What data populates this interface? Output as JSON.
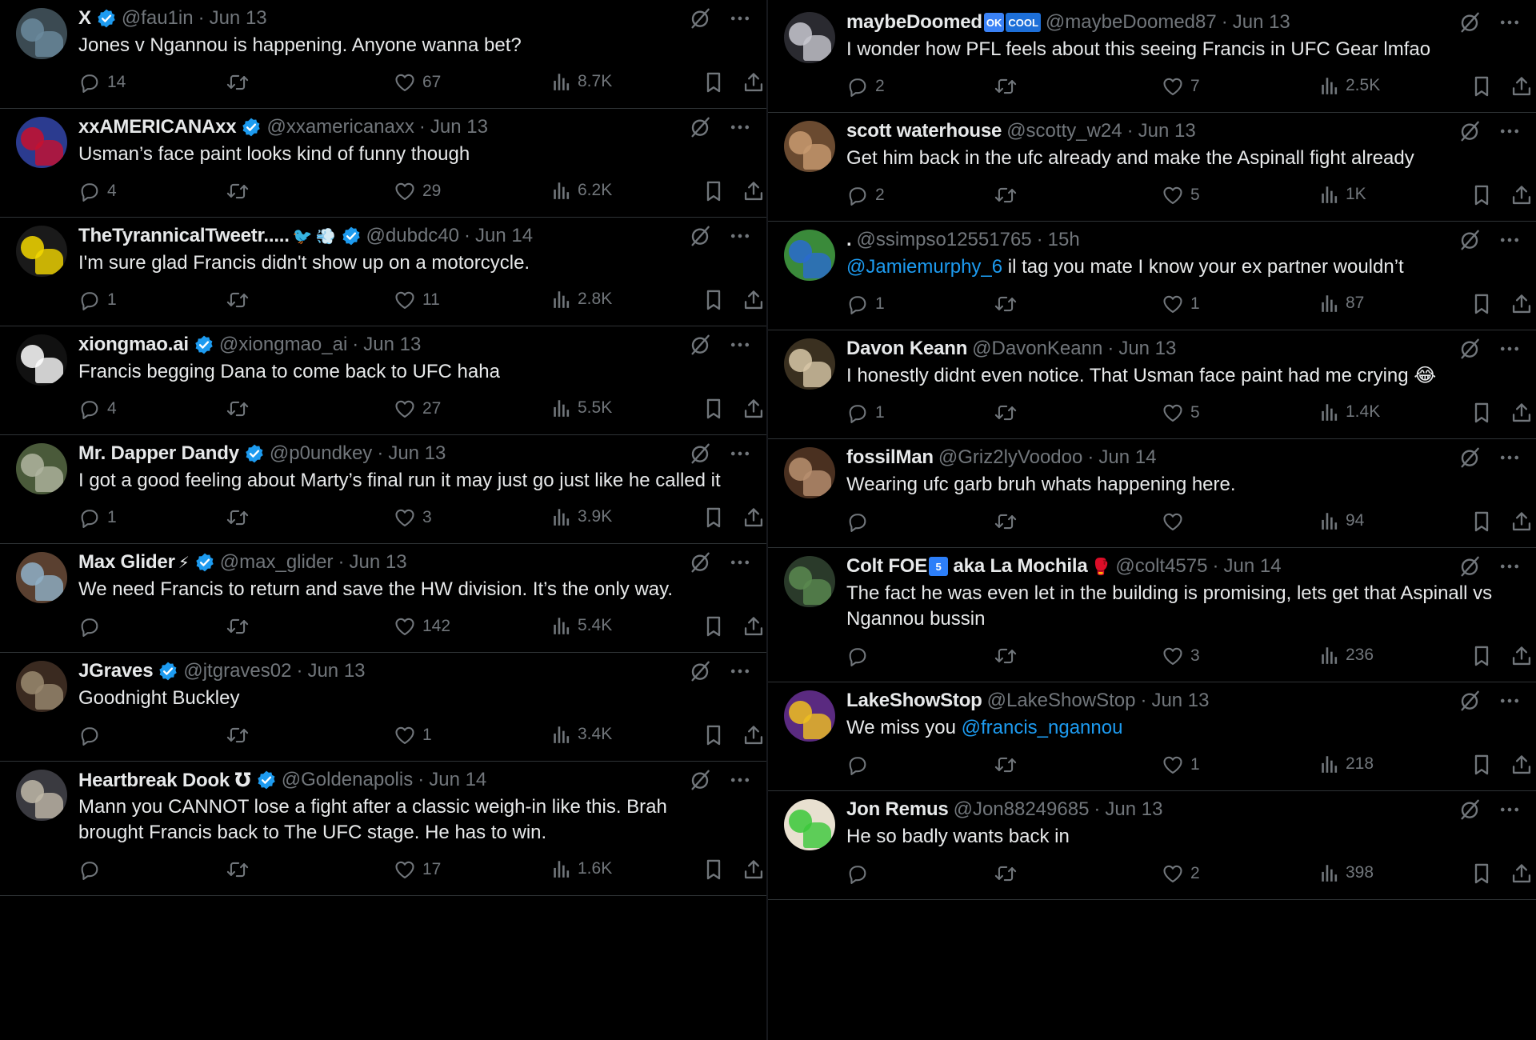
{
  "colors": {
    "background": "#000000",
    "text": "#e7e9ea",
    "muted": "#71767b",
    "link": "#1d9bf0",
    "verified": "#1d9bf0",
    "divider": "#2f3336"
  },
  "icons": {
    "reply": "reply-icon",
    "retweet": "retweet-icon",
    "like": "heart-icon",
    "views": "views-icon",
    "bookmark": "bookmark-icon",
    "share": "share-icon",
    "grok": "grok-icon",
    "more": "more-icon",
    "verified": "verified-badge-icon"
  },
  "left_column": [
    {
      "name": "X",
      "verified": true,
      "extras": [],
      "handle": "@fau1in",
      "time": "Jun 13",
      "text": "Jones v Ngannou is happening. Anyone wanna bet?",
      "replies": "14",
      "likes": "67",
      "views": "8.7K",
      "avatar_colors": [
        "#6b8a9e",
        "#3b4a52"
      ]
    },
    {
      "name": "xxAMERICANAxx",
      "verified": true,
      "extras": [],
      "handle": "@xxamericanaxx",
      "time": "Jun 13",
      "text": "Usman’s face paint looks kind of funny though",
      "replies": "4",
      "likes": "29",
      "views": "6.2K",
      "avatar_colors": [
        "#c8102e",
        "#2b3b8f"
      ]
    },
    {
      "name": "TheTyrannicalTweetr.....",
      "verified": true,
      "extras": [
        "🐦",
        "💨"
      ],
      "handle": "@dubdc40",
      "time": "Jun 14",
      "text": "I'm sure glad Francis didn't show up on a motorcycle.",
      "replies": "1",
      "likes": "11",
      "views": "2.8K",
      "avatar_colors": [
        "#f5d800",
        "#1a1a1a"
      ]
    },
    {
      "name": "xiongmao.ai",
      "verified": true,
      "extras": [],
      "handle": "@xiongmao_ai",
      "time": "Jun 13",
      "text": "Francis begging Dana to come back to UFC haha",
      "replies": "4",
      "likes": "27",
      "views": "5.5K",
      "avatar_colors": [
        "#ffffff",
        "#111111"
      ]
    },
    {
      "name": "Mr. Dapper Dandy",
      "verified": true,
      "extras": [],
      "handle": "@p0undkey",
      "time": "Jun 13",
      "text": "I got a good feeling about Marty’s final run it may just go just like he called it",
      "replies": "1",
      "likes": "3",
      "views": "3.9K",
      "avatar_colors": [
        "#b0b5a0",
        "#4a5a3a"
      ]
    },
    {
      "name": "Max Glider",
      "verified": true,
      "extras": [
        "⚡"
      ],
      "handle": "@max_glider",
      "time": "Jun 13",
      "text": "We need Francis to return and save the HW division. It’s the only way.",
      "replies": "",
      "likes": "142",
      "views": "5.4K",
      "avatar_colors": [
        "#8fb0c8",
        "#5a4030"
      ]
    },
    {
      "name": "JGraves",
      "verified": true,
      "extras": [],
      "handle": "@jtgraves02",
      "time": "Jun 13",
      "text": "Goodnight Buckley",
      "replies": "",
      "likes": "1",
      "views": "3.4K",
      "avatar_colors": [
        "#9a8a70",
        "#3a2a20"
      ]
    },
    {
      "name": "Heartbreak Dook ℧",
      "verified": true,
      "extras": [],
      "handle": "@Goldenapolis",
      "time": "Jun 14",
      "text": "Mann you CANNOT lose a fight after a classic weigh-in like this. Brah brought Francis back to The UFC stage. He has to win.",
      "replies": "",
      "likes": "17",
      "views": "1.6K",
      "avatar_colors": [
        "#c0b8a8",
        "#3a3a40"
      ]
    }
  ],
  "right_column": [
    {
      "name": "maybeDoomed",
      "verified": false,
      "badges": [
        {
          "text": "OK",
          "color": "#3b82f6"
        },
        {
          "text": "COOL",
          "color": "#1d6fd8"
        }
      ],
      "extras": [],
      "handle": "@maybeDoomed87",
      "time": "Jun 13",
      "text": "I wonder how PFL feels about this seeing Francis in UFC Gear lmfao",
      "replies": "2",
      "likes": "7",
      "views": "2.5K",
      "avatar_colors": [
        "#c8c8d0",
        "#2a2a30"
      ]
    },
    {
      "name": "scott waterhouse",
      "verified": false,
      "badges": [],
      "extras": [],
      "handle": "@scotty_w24",
      "time": "Jun 13",
      "text": "Get him back in the ufc already and make the Aspinall fight already",
      "replies": "2",
      "likes": "5",
      "views": "1K",
      "avatar_colors": [
        "#c89a70",
        "#6a4a30"
      ]
    },
    {
      "name": ".",
      "verified": false,
      "badges": [],
      "extras": [],
      "handle": "@ssimpso12551765",
      "time": "15h",
      "mention": "@Jamiemurphy_6",
      "text": " il tag you mate I know your ex partner  wouldn’t",
      "replies": "1",
      "likes": "1",
      "views": "87",
      "avatar_colors": [
        "#2a6ad0",
        "#3a8a3a"
      ]
    },
    {
      "name": "Davon Keann",
      "verified": false,
      "badges": [],
      "extras": [],
      "handle": "@DavonKeann",
      "time": "Jun 13",
      "text": "I honestly didnt even notice. That Usman face paint had me crying 😂",
      "replies": "1",
      "likes": "5",
      "views": "1.4K",
      "avatar_colors": [
        "#d8c8a8",
        "#3a3020"
      ]
    },
    {
      "name": "fossilMan",
      "verified": false,
      "badges": [],
      "extras": [],
      "handle": "@Griz2lyVoodoo",
      "time": "Jun 14",
      "text": "Wearing ufc garb bruh whats happening here.",
      "replies": "",
      "likes": "",
      "views": "94",
      "avatar_colors": [
        "#b89070",
        "#4a3020"
      ]
    },
    {
      "name": "Colt FOE",
      "verified": false,
      "badges": [
        {
          "text": "5",
          "color": "#2d7ff9"
        }
      ],
      "extras_after": [
        " aka La Mochila",
        "🥊"
      ],
      "extras": [],
      "handle": "@colt4575",
      "time": "Jun 14",
      "text": "The fact he was even let in the building is promising, lets get that Aspinall vs Ngannou bussin",
      "replies": "",
      "likes": "3",
      "views": "236",
      "avatar_colors": [
        "#5a8a50",
        "#2a3a2a"
      ]
    },
    {
      "name": "LakeShowStop",
      "verified": false,
      "badges": [],
      "extras": [],
      "handle": "@LakeShowStop",
      "time": "Jun 13",
      "text_prefix": "We miss you ",
      "mention": "@francis_ngannou",
      "text": "",
      "replies": "",
      "likes": "1",
      "views": "218",
      "avatar_colors": [
        "#f0c020",
        "#5a2a80"
      ]
    },
    {
      "name": "Jon Remus",
      "verified": false,
      "badges": [],
      "extras": [],
      "handle": "@Jon88249685",
      "time": "Jun 13",
      "text": "He so badly wants back in",
      "replies": "",
      "likes": "2",
      "views": "398",
      "avatar_colors": [
        "#3ac83a",
        "#e8e0d0"
      ]
    }
  ]
}
